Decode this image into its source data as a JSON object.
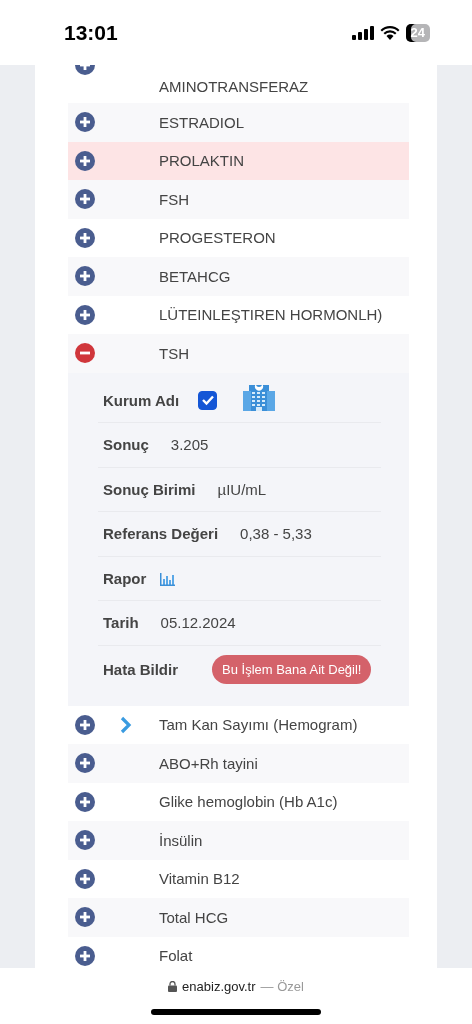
{
  "status_bar": {
    "time": "13:01",
    "battery": "24"
  },
  "tests": [
    {
      "name": "AMINOTRANSFERAZ",
      "kind": "test",
      "expanded": false,
      "highlighted": false
    },
    {
      "name": "ESTRADIOL",
      "kind": "test",
      "expanded": false,
      "highlighted": false
    },
    {
      "name": "PROLAKTIN",
      "kind": "test",
      "expanded": false,
      "highlighted": true
    },
    {
      "name": "FSH",
      "kind": "test",
      "expanded": false,
      "highlighted": false
    },
    {
      "name": "PROGESTERON",
      "kind": "test",
      "expanded": false,
      "highlighted": false
    },
    {
      "name": "BETAHCG",
      "kind": "test",
      "expanded": false,
      "highlighted": false
    },
    {
      "name": "LÜTEINLEŞTIREN HORMONLH)",
      "kind": "test",
      "expanded": false,
      "highlighted": false
    },
    {
      "name": "TSH",
      "kind": "test",
      "expanded": true,
      "highlighted": false,
      "details": [
        {
          "label": "Kurum Adı",
          "kind": "checkbox",
          "checked": true
        },
        {
          "label": "Sonuç",
          "kind": "text",
          "value": "3.205"
        },
        {
          "label": "Sonuç Birimi",
          "kind": "text",
          "value": "µIU/mL"
        },
        {
          "label": "Referans Değeri",
          "kind": "text",
          "value": "0,38 - 5,33"
        },
        {
          "label": "Rapor",
          "kind": "chart"
        },
        {
          "label": "Tarih",
          "kind": "text",
          "value": "05.12.2024"
        },
        {
          "label": "Hata Bildir",
          "kind": "button",
          "value": "Bu İşlem Bana Ait Değil!"
        }
      ]
    },
    {
      "name": "Tam Kan Sayımı (Hemogram)",
      "kind": "group",
      "expanded": false,
      "highlighted": false
    },
    {
      "name": "ABO+Rh tayini",
      "kind": "test",
      "expanded": false,
      "highlighted": false
    },
    {
      "name": "Glike hemoglobin (Hb A1c)",
      "kind": "test",
      "expanded": false,
      "highlighted": false
    },
    {
      "name": "İnsülin",
      "kind": "test",
      "expanded": false,
      "highlighted": false
    },
    {
      "name": "Vitamin B12",
      "kind": "test",
      "expanded": false,
      "highlighted": false
    },
    {
      "name": "Total HCG",
      "kind": "test",
      "expanded": false,
      "highlighted": false
    },
    {
      "name": "Folat",
      "kind": "test",
      "expanded": false,
      "highlighted": false
    }
  ],
  "address_bar": {
    "domain": "enabiz.gov.tr",
    "mode": "— Özel"
  }
}
